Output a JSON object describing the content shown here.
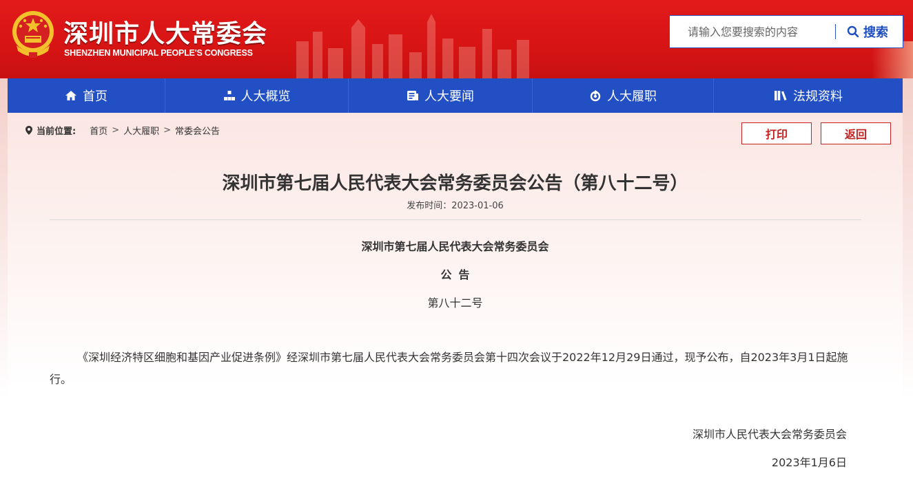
{
  "header": {
    "title": "深圳市人大常委会",
    "subtitle": "SHENZHEN MUNICIPAL PEOPLE'S CONGRESS",
    "search_placeholder": "请输入您要搜索的内容",
    "search_label": "搜索"
  },
  "nav": {
    "items": [
      {
        "label": "首页",
        "icon": "home-icon"
      },
      {
        "label": "人大概览",
        "icon": "org-chart-icon"
      },
      {
        "label": "人大要闻",
        "icon": "news-icon"
      },
      {
        "label": "人大履职",
        "icon": "duty-icon"
      },
      {
        "label": "法规资料",
        "icon": "books-icon"
      }
    ]
  },
  "breadcrumb": {
    "label": "当前位置:",
    "items": [
      "首页",
      "人大履职",
      "常委会公告"
    ],
    "separator": ">"
  },
  "actions": {
    "print": "打印",
    "back": "返回"
  },
  "article": {
    "title": "深圳市第七届人民代表大会常务委员会公告（第八十二号）",
    "publish_time": "发布时间：2023-01-06",
    "org": "深圳市第七届人民代表大会常务委员会",
    "announcement": "公告",
    "number": "第八十二号",
    "body": "《深圳经济特区细胞和基因产业促进条例》经深圳市第七届人民代表大会常务委员会第十四次会议于2022年12月29日通过，现予公布，自2023年3月1日起施行。",
    "sign_org": "深圳市人民代表大会常务委员会",
    "sign_date": "2023年1月6日"
  },
  "colors": {
    "header_red": "#d81414",
    "nav_blue": "#2250c4",
    "accent_red": "#c42121"
  }
}
